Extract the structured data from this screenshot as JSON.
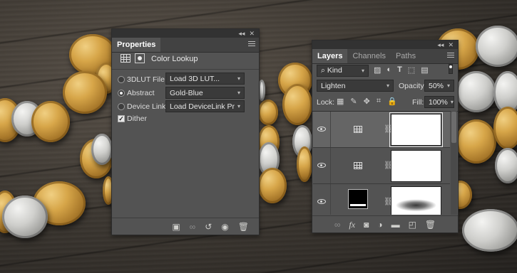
{
  "properties_panel": {
    "tab": "Properties",
    "header_title": "Color Lookup",
    "options": [
      {
        "label": "3DLUT File",
        "value": "Load 3D LUT...",
        "selected": false
      },
      {
        "label": "Abstract",
        "value": "Gold-Blue",
        "selected": true
      },
      {
        "label": "Device Link",
        "value": "Load DeviceLink Profil...",
        "selected": false
      }
    ],
    "dither_label": "Dither",
    "dither_checked": true,
    "top_controls": {
      "collapse": "◂◂",
      "close": "✕"
    }
  },
  "layers_panel": {
    "tabs": [
      "Layers",
      "Channels",
      "Paths"
    ],
    "active_tab": "Layers",
    "top_controls": {
      "collapse": "◂◂",
      "close": "✕"
    },
    "filter_kind": "Kind",
    "blend_mode": "Lighten",
    "opacity_label": "Opacity:",
    "opacity_value": "50%",
    "lock_label": "Lock:",
    "fill_label": "Fill:",
    "fill_value": "100%",
    "layers": [
      {
        "type": "color-lookup adjustment",
        "visible": true
      },
      {
        "type": "color-lookup adjustment",
        "visible": true
      },
      {
        "type": "image with shadow mask",
        "visible": true
      }
    ],
    "bottom_icons": [
      "link-layers-icon",
      "fx-icon",
      "add-mask-icon",
      "adjustment-layer-icon",
      "new-group-icon",
      "new-layer-icon",
      "delete-icon"
    ]
  },
  "colors": {
    "panel": "#535353",
    "panel_dark": "#424242",
    "field": "#3a3a3a",
    "selected_row": "#656565"
  }
}
